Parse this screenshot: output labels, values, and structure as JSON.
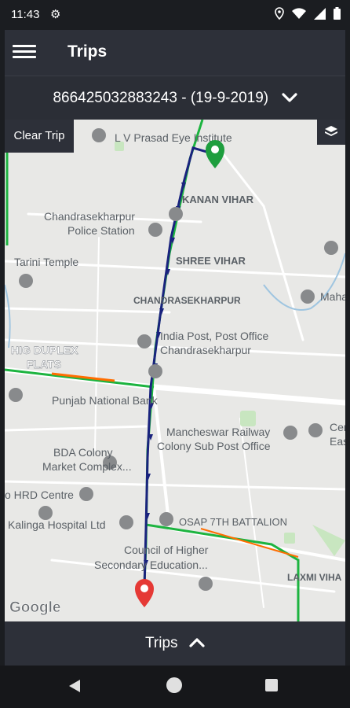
{
  "status_bar": {
    "time": "11:43"
  },
  "app_bar": {
    "title": "Trips",
    "menu_icon": "hamburger-icon"
  },
  "device_selector": {
    "label": "866425032883243 - (19-9-2019)",
    "icon": "chevron-down-icon"
  },
  "map": {
    "clear_trip_label": "Clear Trip",
    "layers_icon": "layers-icon",
    "watermark": "Google",
    "route_color": "#1a237e",
    "start_color": "#1e9e3e",
    "end_color": "#e53935",
    "labels": {
      "lv_prasad": "L V Prasad Eye Institute",
      "kanan_vihar": "KANAN VIHAR",
      "police_1": "Chandrasekharpur",
      "police_2": "Police Station",
      "tarini": "Tarini Temple",
      "shree_vihar": "SHREE VIHAR",
      "chandrasekharpur": "CHANDRASEKHARPUR",
      "maha": "Maha",
      "postoffice_1": "India Post, Post Office",
      "postoffice_2": "Chandrasekharpur",
      "hig_1": "HIG DUPLEX",
      "hig_2": "FLATS",
      "pnb": "Punjab National Bank",
      "mancheswar_1": "Mancheswar Railway",
      "mancheswar_2": "Colony Sub Post Office",
      "cen_1": "Cen",
      "cen_2": "Eas",
      "bda_1": "BDA Colony",
      "bda_2": "Market Complex...",
      "hrd": "o HRD Centre",
      "kalinga": "Kalinga Hospital Ltd",
      "osap": "OSAP 7TH BATTALION",
      "council_1": "Council of Higher",
      "council_2": "Secondary Education...",
      "laxmi": "LAXMI VIHA"
    }
  },
  "bottom_bar": {
    "label": "Trips",
    "icon": "chevron-up-icon"
  }
}
